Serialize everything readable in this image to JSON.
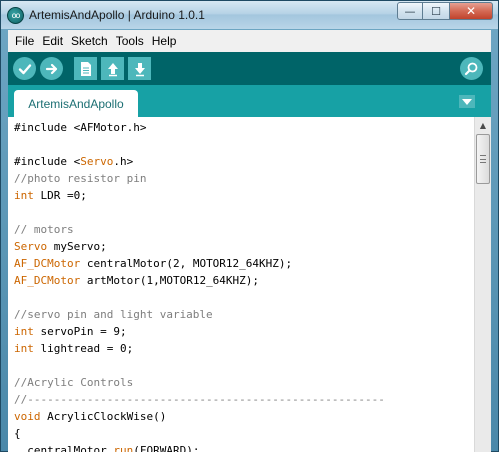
{
  "window": {
    "title": "ArtemisAndApollo | Arduino 1.0.1",
    "app_icon_glyph": "oo",
    "minimize_glyph": "—",
    "maximize_glyph": "☐",
    "close_glyph": "✕"
  },
  "menu": {
    "items": [
      "File",
      "Edit",
      "Sketch",
      "Tools",
      "Help"
    ]
  },
  "toolbar": {
    "buttons": [
      {
        "name": "verify",
        "icon": "check-icon"
      },
      {
        "name": "upload",
        "icon": "arrow-right-icon"
      },
      {
        "name": "new",
        "icon": "new-file-icon"
      },
      {
        "name": "open",
        "icon": "arrow-up-icon"
      },
      {
        "name": "save",
        "icon": "arrow-down-icon"
      }
    ],
    "serial_monitor_icon": "magnifier-icon"
  },
  "tabs": {
    "active": "ArtemisAndApollo"
  },
  "editor": {
    "lines": [
      [
        {
          "t": "#include <AFMotor.h>",
          "c": ""
        }
      ],
      [
        {
          "t": "",
          "c": ""
        }
      ],
      [
        {
          "t": "#include <",
          "c": ""
        },
        {
          "t": "Servo",
          "c": "kw"
        },
        {
          "t": ".h>",
          "c": ""
        }
      ],
      [
        {
          "t": "//photo resistor pin",
          "c": "cm"
        }
      ],
      [
        {
          "t": "int",
          "c": "kw"
        },
        {
          "t": " LDR =0;",
          "c": ""
        }
      ],
      [
        {
          "t": "",
          "c": ""
        }
      ],
      [
        {
          "t": "// motors",
          "c": "cm"
        }
      ],
      [
        {
          "t": "Servo",
          "c": "kw"
        },
        {
          "t": " myServo;",
          "c": ""
        }
      ],
      [
        {
          "t": "AF_DCMotor",
          "c": "kw"
        },
        {
          "t": " centralMotor(2, MOTOR12_64KHZ);",
          "c": ""
        }
      ],
      [
        {
          "t": "AF_DCMotor",
          "c": "kw"
        },
        {
          "t": " artMotor(1,MOTOR12_64KHZ);",
          "c": ""
        }
      ],
      [
        {
          "t": "",
          "c": ""
        }
      ],
      [
        {
          "t": "//servo pin and light variable",
          "c": "cm"
        }
      ],
      [
        {
          "t": "int",
          "c": "kw"
        },
        {
          "t": " servoPin = 9;",
          "c": ""
        }
      ],
      [
        {
          "t": "int",
          "c": "kw"
        },
        {
          "t": " lightread = 0;",
          "c": ""
        }
      ],
      [
        {
          "t": "",
          "c": ""
        }
      ],
      [
        {
          "t": "//Acrylic Controls",
          "c": "cm"
        }
      ],
      [
        {
          "t": "//------------------------------------------------------",
          "c": "cm"
        }
      ],
      [
        {
          "t": "void",
          "c": "kw"
        },
        {
          "t": " AcrylicClockWise()",
          "c": ""
        }
      ],
      [
        {
          "t": "{",
          "c": ""
        }
      ],
      [
        {
          "t": "  centralMotor.",
          "c": ""
        },
        {
          "t": "run",
          "c": "kw"
        },
        {
          "t": "(FORWARD);",
          "c": ""
        }
      ]
    ]
  },
  "colors": {
    "toolbar_bg": "#006468",
    "tab_strip_bg": "#17a1a5",
    "button_bg": "#4db7bb",
    "keyword": "#cc6600",
    "comment": "#7e7e7e"
  }
}
